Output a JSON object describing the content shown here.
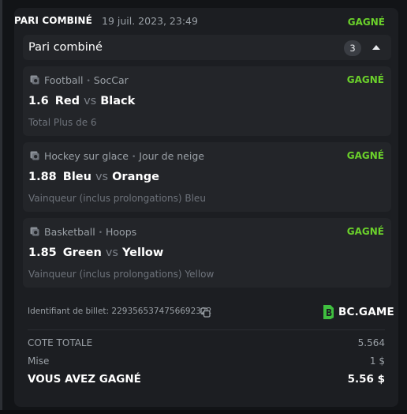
{
  "header": {
    "title": "PARI COMBINÉ",
    "date": "19 juil. 2023, 23:49",
    "status": "GAGNÉ"
  },
  "subheader": {
    "title": "Pari combiné",
    "count": "3",
    "toggle_icon": "caret-up-icon"
  },
  "legs": [
    {
      "sport": "Football",
      "league": "SocCar",
      "status": "GAGNÉ",
      "odds": "1.6",
      "team_home": "Red",
      "vs": "vs",
      "team_away": "Black",
      "market": "Total Plus de 6"
    },
    {
      "sport": "Hockey sur glace",
      "league": "Jour de neige",
      "status": "GAGNÉ",
      "odds": "1.88",
      "team_home": "Bleu",
      "vs": "vs",
      "team_away": "Orange",
      "market": "Vainqueur (inclus prolongations) Bleu"
    },
    {
      "sport": "Basketball",
      "league": "Hoops",
      "status": "GAGNÉ",
      "odds": "1.85",
      "team_home": "Green",
      "vs": "vs",
      "team_away": "Yellow",
      "market": "Vainqueur (inclus prolongations) Yellow"
    }
  ],
  "ticket": {
    "label": "Identifiant de billet: 2293565374756692322",
    "copy_icon": "copy-icon"
  },
  "brand": {
    "name": "BC.GAME",
    "logo_icon": "bcgame-logo-icon"
  },
  "summary": {
    "total_odds_label": "COTE TOTALE",
    "total_odds_value": "5.564",
    "stake_label": "Mise",
    "stake_value": "1 $",
    "won_label": "VOUS AVEZ GAGNÉ",
    "won_value": "5.56 $"
  },
  "colors": {
    "background": "#121417",
    "card": "#1c1e22",
    "panel": "#232529",
    "win_green": "#6bd12b",
    "muted_text": "#9aa0a6"
  }
}
